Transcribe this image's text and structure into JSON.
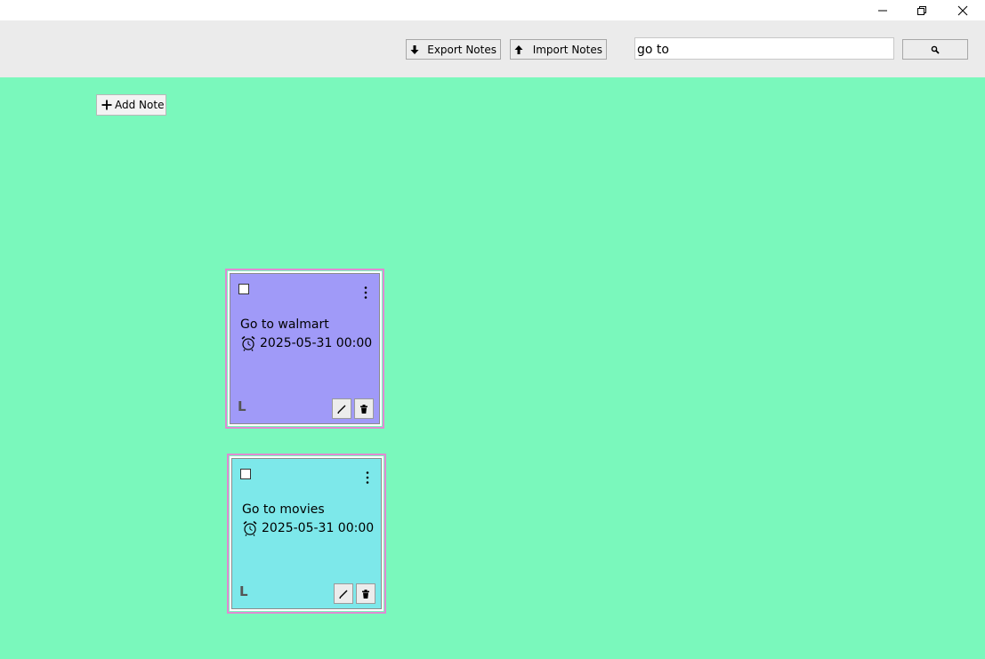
{
  "toolbar": {
    "export_label": "Export Notes",
    "import_label": "Import Notes",
    "search_value": "go to"
  },
  "main": {
    "add_note_label": "Add Note"
  },
  "notes": [
    {
      "title": "Go to walmart",
      "reminder": "2025-05-31 00:00",
      "tag": "L",
      "color": "#a09af8",
      "checked": false
    },
    {
      "title": "Go to movies",
      "reminder": "2025-05-31 00:00",
      "tag": "L",
      "color": "#7de8ea",
      "checked": false
    }
  ],
  "colors": {
    "background": "#7af8bc",
    "toolbar": "#ebebeb",
    "note_border": "#e08ad2"
  },
  "icons": {
    "window": [
      "minimize-icon",
      "maximize-icon",
      "close-icon"
    ],
    "toolbar": [
      "arrow-down-icon",
      "arrow-up-icon",
      "search-icon"
    ],
    "note": [
      "menu-dots-icon",
      "alarm-clock-icon",
      "pencil-icon",
      "trash-icon"
    ]
  }
}
